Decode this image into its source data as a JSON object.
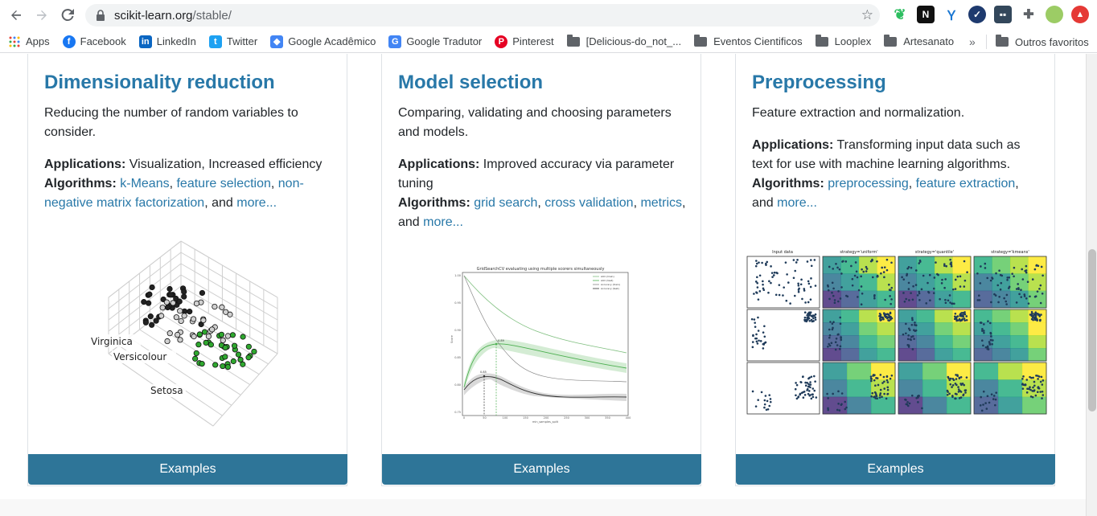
{
  "browser": {
    "url_domain": "scikit-learn.org",
    "url_path": "/stable/",
    "bookmarks": [
      {
        "label": "Apps",
        "icon": "apps-grid-icon",
        "color": "#ea4335"
      },
      {
        "label": "Facebook",
        "icon": "facebook-icon",
        "color": "#1877f2"
      },
      {
        "label": "LinkedIn",
        "icon": "linkedin-icon",
        "color": "#0a66c2"
      },
      {
        "label": "Twitter",
        "icon": "twitter-icon",
        "color": "#1da1f2"
      },
      {
        "label": "Google Acadêmico",
        "icon": "scholar-icon",
        "color": "#4285f4"
      },
      {
        "label": "Google Tradutor",
        "icon": "translate-icon",
        "color": "#4285f4"
      },
      {
        "label": "Pinterest",
        "icon": "pinterest-icon",
        "color": "#e60023"
      },
      {
        "label": "[Delicious-do_not_...",
        "icon": "folder-icon",
        "color": "#5f6368"
      },
      {
        "label": "Eventos Cientificos",
        "icon": "folder-icon",
        "color": "#5f6368"
      },
      {
        "label": "Looplex",
        "icon": "folder-icon",
        "color": "#5f6368"
      },
      {
        "label": "Artesanato",
        "icon": "folder-icon",
        "color": "#5f6368"
      }
    ],
    "overflow_label": "»",
    "other_bookmarks": "Outros favoritos"
  },
  "cards": [
    {
      "title": "Dimensionality reduction",
      "description": "Reducing the number of random variables to consider.",
      "applications_label": "Applications:",
      "applications_text": "Visualization, Increased efficiency",
      "algorithms_label": "Algorithms:",
      "links": [
        "k-Means",
        "feature selection",
        "non-negative matrix factorization"
      ],
      "sep1": ", ",
      "sep2": ", ",
      "and_text": ", and ",
      "more": "more...",
      "figure": {
        "labels": [
          "Virginica",
          "Versicolour",
          "Setosa"
        ]
      },
      "button": "Examples"
    },
    {
      "title": "Model selection",
      "description": "Comparing, validating and choosing parameters and models.",
      "applications_label": "Applications:",
      "applications_text": "Improved accuracy via parameter tuning",
      "algorithms_label": "Algorithms:",
      "links": [
        "grid search",
        "cross validation",
        "metrics"
      ],
      "sep1": ", ",
      "sep2": ", ",
      "and_text": ", and ",
      "more": "more...",
      "figure": {
        "title": "GridSearchCV evaluating using multiple scorers simultaneously",
        "xlabel": "min_samples_split",
        "ylabel": "Score",
        "legend": [
          "AUC (train)",
          "AUC (test)",
          "Accuracy (train)",
          "Accuracy (test)"
        ],
        "annotations": [
          "0.89",
          "0.85"
        ],
        "xticks": [
          "0",
          "50",
          "100",
          "150",
          "200",
          "250",
          "300",
          "350",
          "400"
        ],
        "yticks": [
          "1.00",
          "0.95",
          "0.90",
          "0.85",
          "0.80",
          "0.75"
        ]
      },
      "button": "Examples"
    },
    {
      "title": "Preprocessing",
      "description": "Feature extraction and normalization.",
      "applications_label": "Applications:",
      "applications_text": "Transforming input data such as text for use with machine learning algorithms.",
      "algorithms_label": "Algorithms:",
      "links": [
        "preprocessing",
        "feature extraction"
      ],
      "sep1": ", ",
      "and_text": ", and ",
      "more": "more...",
      "figure": {
        "column_titles": [
          "Input data",
          "strategy='uniform'",
          "strategy='quantile'",
          "strategy='kmeans'"
        ]
      },
      "button": "Examples"
    }
  ]
}
